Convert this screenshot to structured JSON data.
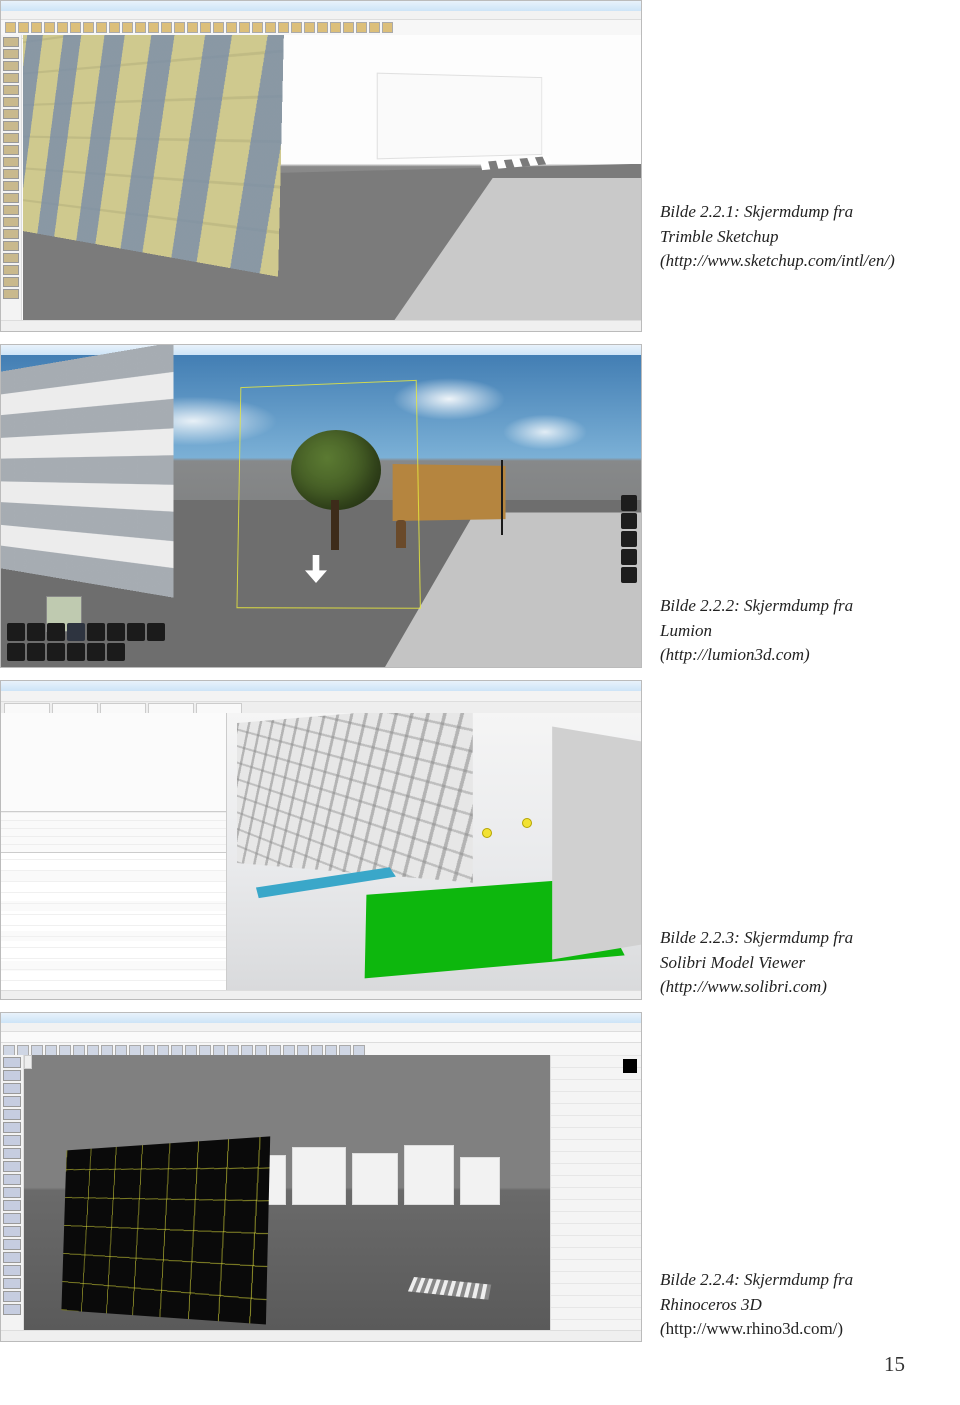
{
  "captions": {
    "c1": {
      "label": "Bilde 2.2.1: Skjermdump fra Trimble Sketchup",
      "url": "(http://www.sketchup.com/intl/en/)"
    },
    "c2": {
      "label": "Bilde 2.2.2: Skjermdump fra Lumion",
      "url": "(http://lumion3d.com)"
    },
    "c3": {
      "label": "Bilde 2.2.3: Skjermdump fra Solibri Model Viewer",
      "url": "(http://www.solibri.com)"
    },
    "c4": {
      "label": "Bilde 2.2.4: Skjermdump fra Rhinoceros 3D",
      "url_prefix": "(",
      "url_text": "http://www.rhino3d.com/)"
    }
  },
  "page_number": "15"
}
